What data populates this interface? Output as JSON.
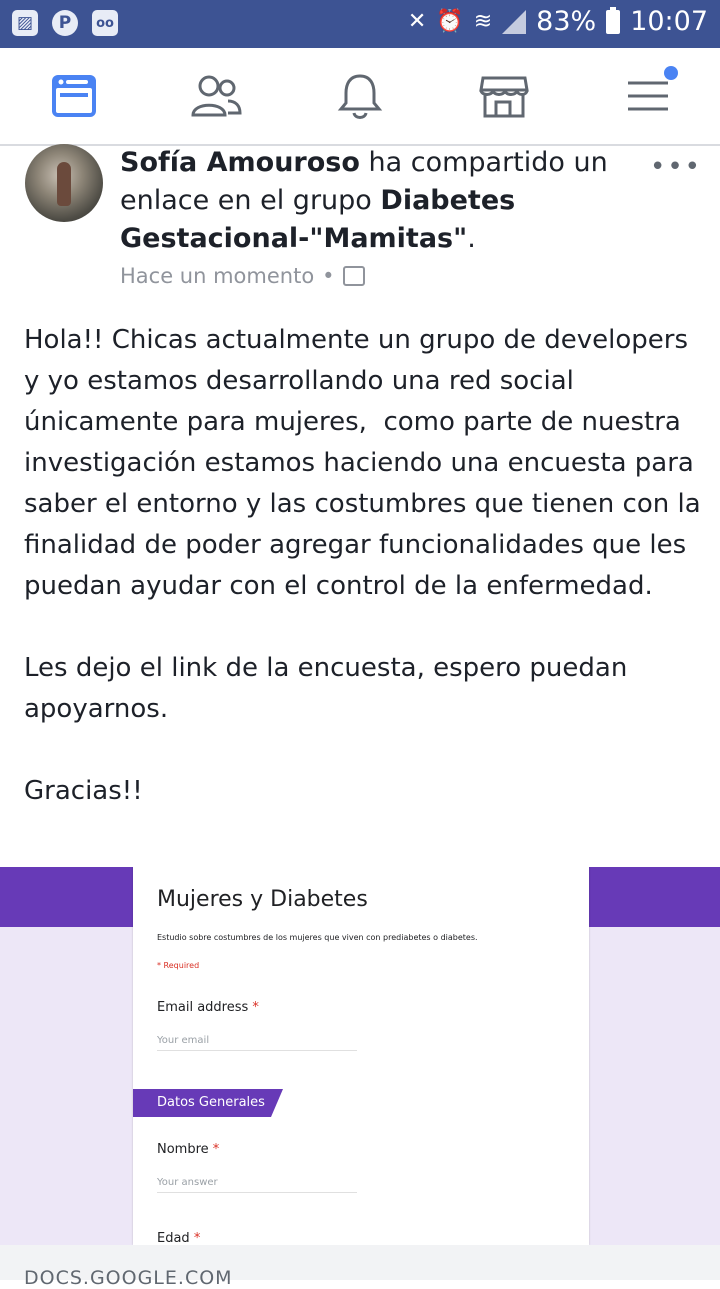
{
  "status_bar": {
    "battery": "83%",
    "time": "10:07",
    "icons": [
      "image-icon",
      "pinterest-icon",
      "voicemail-icon",
      "mute-icon",
      "alarm-icon",
      "wifi-icon",
      "signal-icon",
      "battery-icon"
    ]
  },
  "nav": {
    "items": [
      "news-feed-icon",
      "friends-icon",
      "notifications-icon",
      "marketplace-icon",
      "menu-icon"
    ],
    "menu_has_badge": true,
    "active_color": "#4a83f3"
  },
  "post": {
    "author": "Sofía Amouroso",
    "action": " ha compartido un enlace en el grupo ",
    "group": "Diabetes Gestacional-\"Mamitas\"",
    "group_suffix": ".",
    "time": "Hace un momento",
    "separator": "•",
    "body": "Hola!! Chicas actualmente un grupo de developers  y yo estamos desarrollando una red social únicamente para mujeres,  como parte de nuestra investigación estamos haciendo una encuesta para saber el entorno y las costumbres que tienen con la finalidad de poder agregar funcionalidades que les puedan ayudar con el control de la enfermedad.\n\nLes dejo el link de la encuesta, espero puedan apoyarnos.\n\nGracias!!"
  },
  "link_preview": {
    "form_title": "Mujeres y Diabetes",
    "form_description": "Estudio sobre costumbres de los mujeres que viven con prediabetes o diabetes.",
    "required_note": "* Required",
    "email_label": "Email address",
    "email_placeholder": "Your email",
    "section_title": "Datos Generales",
    "name_label": "Nombre",
    "name_placeholder": "Your answer",
    "age_label": "Edad",
    "required_star": "*",
    "domain": "DOCS.GOOGLE.COM"
  }
}
